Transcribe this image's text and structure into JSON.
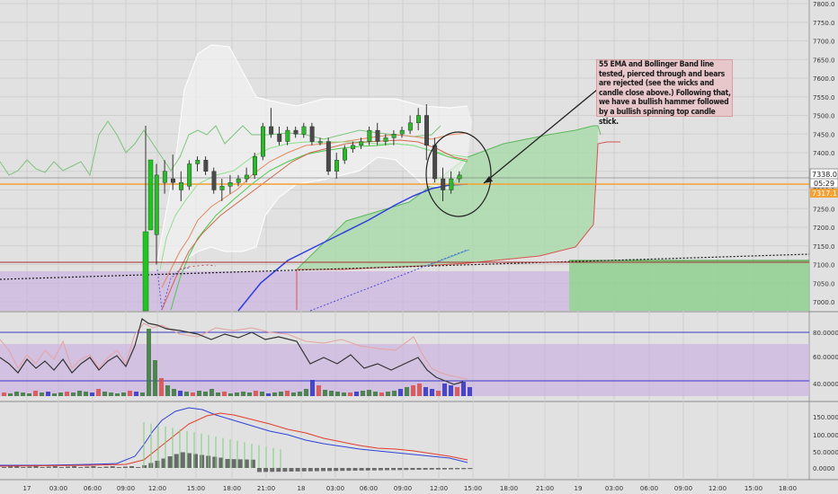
{
  "chart_data": [
    {
      "type": "line",
      "title": "",
      "series": [
        {
          "type": "candlestick",
          "values": [
            [
              7180,
              7370,
              7100,
              7340
            ],
            [
              7320,
              7380,
              7290,
              7350
            ],
            [
              7330,
              7395,
              7300,
              7320
            ],
            [
              7300,
              7350,
              7270,
              7320
            ],
            [
              7310,
              7380,
              7300,
              7370
            ],
            [
              7370,
              7390,
              7350,
              7380
            ],
            [
              7380,
              7390,
              7340,
              7350
            ],
            [
              7350,
              7360,
              7290,
              7300
            ],
            [
              7300,
              7330,
              7270,
              7310
            ],
            [
              7310,
              7340,
              7290,
              7320
            ],
            [
              7320,
              7340,
              7310,
              7330
            ],
            [
              7330,
              7360,
              7320,
              7340
            ],
            [
              7340,
              7400,
              7330,
              7390
            ],
            [
              7390,
              7480,
              7380,
              7470
            ],
            [
              7470,
              7520,
              7440,
              7450
            ],
            [
              7450,
              7470,
              7420,
              7430
            ],
            [
              7430,
              7470,
              7420,
              7460
            ],
            [
              7460,
              7470,
              7440,
              7450
            ],
            [
              7450,
              7480,
              7440,
              7470
            ],
            [
              7470,
              7480,
              7420,
              7430
            ],
            [
              7430,
              7440,
              7420,
              7430
            ],
            [
              7430,
              7440,
              7340,
              7350
            ],
            [
              7350,
              7400,
              7330,
              7380
            ],
            [
              7380,
              7420,
              7370,
              7410
            ],
            [
              7410,
              7430,
              7400,
              7420
            ],
            [
              7420,
              7440,
              7410,
              7430
            ],
            [
              7430,
              7470,
              7420,
              7460
            ],
            [
              7460,
              7480,
              7420,
              7430
            ],
            [
              7430,
              7450,
              7420,
              7440
            ],
            [
              7440,
              7460,
              7420,
              7450
            ],
            [
              7450,
              7470,
              7440,
              7460
            ],
            [
              7460,
              7500,
              7450,
              7480
            ],
            [
              7480,
              7520,
              7460,
              7500
            ],
            [
              7500,
              7530,
              7380,
              7420
            ],
            [
              7420,
              7440,
              7320,
              7330
            ],
            [
              7330,
              7360,
              7270,
              7300
            ],
            [
              7300,
              7350,
              7290,
              7330
            ],
            [
              7330,
              7350,
              7320,
              7340
            ]
          ]
        },
        {
          "type": "line",
          "name": "",
          "values": []
        }
      ],
      "y_ticks": [
        "7800.0",
        "7750.0",
        "7700.0",
        "7650.0",
        "7600.0",
        "7550.0",
        "7500.0",
        "7450.0",
        "7400.0",
        "7350.0",
        "7300.0",
        "7250.0",
        "7200.0",
        "7150.0",
        "7100.0",
        "7050.0",
        "7000.0"
      ],
      "price_labels": {
        "current": "7338.0",
        "time": "05:29",
        "level": "7317.1"
      },
      "annotation": "55 EMA and Bollinger Band line tested, pierced through and bears are rejected (see the wicks and candle close above.) Following that, we have a bullish hammer followed by a bullish spinning top candle stick."
    },
    {
      "type": "bar",
      "y_ticks": [
        "80.0000",
        "60.0000",
        "40.0000"
      ]
    },
    {
      "type": "bar",
      "y_ticks": [
        "150.0000",
        "100.0000",
        "50.0000",
        "0.0000"
      ]
    }
  ],
  "x_ticks": [
    "17",
    "03:00",
    "06:00",
    "09:00",
    "12:00",
    "15:00",
    "18:00",
    "21:00",
    "18",
    "03:00",
    "06:00",
    "09:00",
    "12:00",
    "15:00",
    "18:00",
    "21:00",
    "19",
    "03:00",
    "06:00",
    "09:00",
    "12:00",
    "15:00",
    "18:00"
  ],
  "colors": {
    "up": "#2db82d",
    "down": "#555555",
    "ema": "#2d3ee0",
    "cloud": "#8ed48e",
    "orange": "#f5a033"
  }
}
